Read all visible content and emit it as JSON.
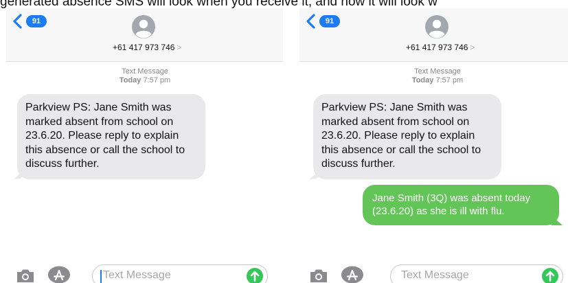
{
  "caption": "generated absence SMS will look when you receive it, and how it will look w",
  "left_phone": {
    "badge_count": "91",
    "contact_number": "+61 417 973 746",
    "contact_arrow": ">",
    "meta_label": "Text Message",
    "meta_day": "Today",
    "meta_time": "7:57 pm",
    "received_message": "Parkview PS: Jane Smith was marked absent from school on 23.6.20. Please reply to explain this absence or call the school to discuss further.",
    "input_placeholder": "Text Message"
  },
  "right_phone": {
    "badge_count": "91",
    "contact_number": "+61 417 973 746",
    "contact_arrow": ">",
    "meta_label": "Text Message",
    "meta_day": "Today",
    "meta_time": "7:57 pm",
    "received_message": "Parkview PS: Jane Smith was marked absent from school on 23.6.20. Please reply to explain this absence or call the school to discuss further.",
    "sent_message": "Jane Smith (3Q) was absent today (23.6.20) as she is ill with flu.",
    "input_placeholder": "Text Message"
  },
  "colors": {
    "accent_blue": "#1b7cf3",
    "received_bubble": "#e9e9eb",
    "sent_bubble": "#63c458",
    "send_button": "#34c759"
  },
  "icons": [
    "chevron-left-icon",
    "avatar-icon",
    "camera-icon",
    "app-store-icon",
    "send-arrow-icon"
  ]
}
